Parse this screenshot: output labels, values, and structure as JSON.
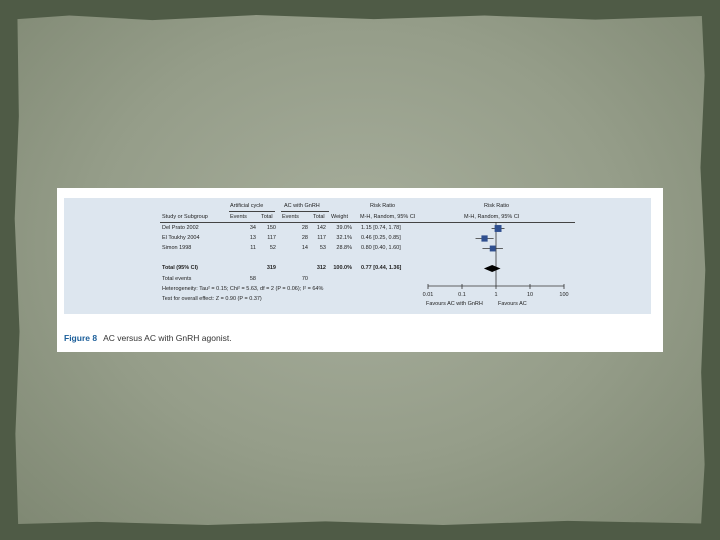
{
  "figure": {
    "headers": {
      "group1": "Artificial cycle",
      "group2": "AC with GnRH",
      "study": "Study or Subgroup",
      "events1": "Events",
      "total1": "Total",
      "events2": "Events",
      "total2": "Total",
      "weight": "Weight",
      "rr_title": "Risk Ratio",
      "rr_method": "M-H, Random, 95% CI",
      "plot_title": "Risk Ratio",
      "plot_method": "M-H, Random, 95% CI"
    },
    "studies": [
      {
        "name": "Del Prato 2002",
        "events1": "34",
        "total1": "150",
        "events2": "28",
        "total2": "142",
        "weight": "39.0%",
        "ci": "1.15 [0.74, 1.78]"
      },
      {
        "name": "El Toukhy 2004",
        "events1": "13",
        "total1": "117",
        "events2": "28",
        "total2": "117",
        "weight": "32.1%",
        "ci": "0.46 [0.25, 0.85]"
      },
      {
        "name": "Simon 1998",
        "events1": "11",
        "total1": "52",
        "events2": "14",
        "total2": "53",
        "weight": "28.8%",
        "ci": "0.80 [0.40, 1.60]"
      }
    ],
    "total": {
      "label": "Total (95% CI)",
      "total1": "319",
      "total2": "312",
      "weight": "100.0%",
      "ci": "0.77 [0.44, 1.36]"
    },
    "total_events": {
      "label": "Total events",
      "events1": "58",
      "events2": "70"
    },
    "heterogeneity": "Heterogeneity: Tau² = 0.15; Chi² = 5.63, df = 2 (P = 0.06); I² = 64%",
    "overall_effect": "Test for overall effect: Z = 0.90 (P = 0.37)",
    "axis": {
      "ticks": [
        "0.01",
        "0.1",
        "1",
        "10",
        "100"
      ],
      "favours_left": "Favours AC with GnRH",
      "favours_right": "Favours AC"
    },
    "caption": {
      "label": "Figure 8",
      "text": "AC versus AC with GnRH agonist."
    },
    "colors": {
      "marker": "#2f4f8f",
      "diamond": "#000000"
    }
  },
  "chart_data": {
    "type": "scatter",
    "x_scale": "log",
    "xlim": [
      0.01,
      100
    ],
    "points": [
      {
        "label": "Del Prato 2002",
        "rr": 1.15,
        "lo": 0.74,
        "hi": 1.78,
        "weight": 39.0
      },
      {
        "label": "El Toukhy 2004",
        "rr": 0.46,
        "lo": 0.25,
        "hi": 0.85,
        "weight": 32.1
      },
      {
        "label": "Simon 1998",
        "rr": 0.8,
        "lo": 0.4,
        "hi": 1.6,
        "weight": 28.8
      }
    ],
    "pooled": {
      "rr": 0.77,
      "lo": 0.44,
      "hi": 1.36
    }
  }
}
